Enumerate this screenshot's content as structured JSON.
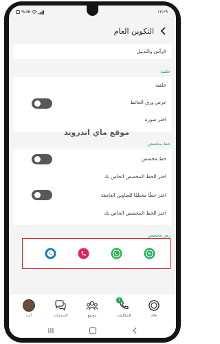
{
  "statusbar": {
    "time": "١٢:٢٩",
    "battery_text": "%36"
  },
  "header": {
    "title": "التكوين العام",
    "back_icon": "chevron-left-icon"
  },
  "rows": {
    "header_footer": "الرأس والتذييل",
    "background_section": "خلفية",
    "background": "خلفية",
    "show_wallpaper": "عرض ورق الحائط",
    "choose_image": "اختر صورة",
    "font_section": "خط مخصص",
    "custom_font": "خط مخصص",
    "choose_custom_font": "اختر الخط المخصص الخاص بك",
    "choose_dark_heading_font": "اختر خطًا مختلفًا للعناوين الغامقة",
    "choose_custom_font_2": "اختر الخط المخصص الخاص بك",
    "icon_section": "رمز مخصص"
  },
  "toggles": {
    "show_wallpaper": "on",
    "custom_font": "on",
    "dark_heading_font": "on"
  },
  "watermark": "موقع ماي اندرويد",
  "custom_icons": [
    {
      "name": "whatsapp-business-icon",
      "color": "#1faa5a"
    },
    {
      "name": "whatsapp-icon",
      "color": "#25b148"
    },
    {
      "name": "red-phone-icon",
      "color": "#e0245e"
    },
    {
      "name": "blue-phone-icon",
      "color": "#1e78c8"
    }
  ],
  "bottom_nav": {
    "status": "حالة",
    "calls": "المكالمات",
    "calls_badge": "1",
    "community": "مجتمع",
    "chats": "الدردشات",
    "you": "أنت"
  },
  "colors": {
    "accent": "#2e9c79",
    "highlight": "#e01818",
    "toggle_on": "#585858"
  }
}
